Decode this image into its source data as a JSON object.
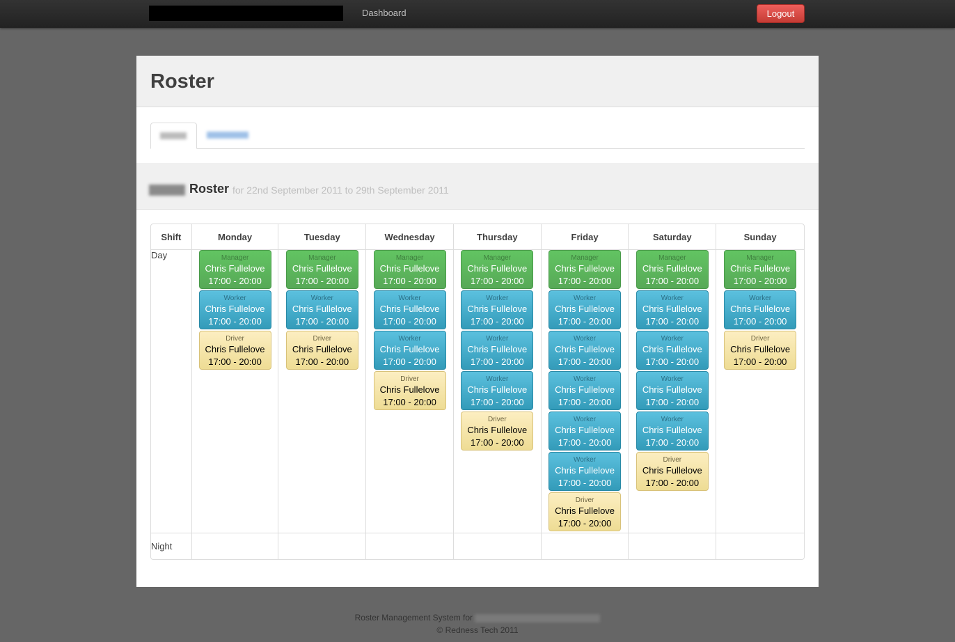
{
  "topbar": {
    "nav_label": "Dashboard",
    "logout_label": "Logout"
  },
  "page": {
    "title": "Roster"
  },
  "roster": {
    "heading": "Roster",
    "subtitle": "for 22nd September 2011 to 29th September 2011"
  },
  "table": {
    "shift_header": "Shift",
    "days": [
      "Monday",
      "Tuesday",
      "Wednesday",
      "Thursday",
      "Friday",
      "Saturday",
      "Sunday"
    ],
    "rows": [
      {
        "label": "Day",
        "days": [
          [
            {
              "role": "Manager",
              "color": "green",
              "name": "Chris Fullelove",
              "time": "17:00 - 20:00"
            },
            {
              "role": "Worker",
              "color": "blue",
              "name": "Chris Fullelove",
              "time": "17:00 - 20:00"
            },
            {
              "role": "Driver",
              "color": "yellow",
              "name": "Chris Fullelove",
              "time": "17:00 - 20:00"
            }
          ],
          [
            {
              "role": "Manager",
              "color": "green",
              "name": "Chris Fullelove",
              "time": "17:00 - 20:00"
            },
            {
              "role": "Worker",
              "color": "blue",
              "name": "Chris Fullelove",
              "time": "17:00 - 20:00"
            },
            {
              "role": "Driver",
              "color": "yellow",
              "name": "Chris Fullelove",
              "time": "17:00 - 20:00"
            }
          ],
          [
            {
              "role": "Manager",
              "color": "green",
              "name": "Chris Fullelove",
              "time": "17:00 - 20:00"
            },
            {
              "role": "Worker",
              "color": "blue",
              "name": "Chris Fullelove",
              "time": "17:00 - 20:00"
            },
            {
              "role": "Worker",
              "color": "blue",
              "name": "Chris Fullelove",
              "time": "17:00 - 20:00"
            },
            {
              "role": "Driver",
              "color": "yellow",
              "name": "Chris Fullelove",
              "time": "17:00 - 20:00"
            }
          ],
          [
            {
              "role": "Manager",
              "color": "green",
              "name": "Chris Fullelove",
              "time": "17:00 - 20:00"
            },
            {
              "role": "Worker",
              "color": "blue",
              "name": "Chris Fullelove",
              "time": "17:00 - 20:00"
            },
            {
              "role": "Worker",
              "color": "blue",
              "name": "Chris Fullelove",
              "time": "17:00 - 20:00"
            },
            {
              "role": "Worker",
              "color": "blue",
              "name": "Chris Fullelove",
              "time": "17:00 - 20:00"
            },
            {
              "role": "Driver",
              "color": "yellow",
              "name": "Chris Fullelove",
              "time": "17:00 - 20:00"
            }
          ],
          [
            {
              "role": "Manager",
              "color": "green",
              "name": "Chris Fullelove",
              "time": "17:00 - 20:00"
            },
            {
              "role": "Worker",
              "color": "blue",
              "name": "Chris Fullelove",
              "time": "17:00 - 20:00"
            },
            {
              "role": "Worker",
              "color": "blue",
              "name": "Chris Fullelove",
              "time": "17:00 - 20:00"
            },
            {
              "role": "Worker",
              "color": "blue",
              "name": "Chris Fullelove",
              "time": "17:00 - 20:00"
            },
            {
              "role": "Worker",
              "color": "blue",
              "name": "Chris Fullelove",
              "time": "17:00 - 20:00"
            },
            {
              "role": "Worker",
              "color": "blue",
              "name": "Chris Fullelove",
              "time": "17:00 - 20:00"
            },
            {
              "role": "Driver",
              "color": "yellow",
              "name": "Chris Fullelove",
              "time": "17:00 - 20:00"
            }
          ],
          [
            {
              "role": "Manager",
              "color": "green",
              "name": "Chris Fullelove",
              "time": "17:00 - 20:00"
            },
            {
              "role": "Worker",
              "color": "blue",
              "name": "Chris Fullelove",
              "time": "17:00 - 20:00"
            },
            {
              "role": "Worker",
              "color": "blue",
              "name": "Chris Fullelove",
              "time": "17:00 - 20:00"
            },
            {
              "role": "Worker",
              "color": "blue",
              "name": "Chris Fullelove",
              "time": "17:00 - 20:00"
            },
            {
              "role": "Worker",
              "color": "blue",
              "name": "Chris Fullelove",
              "time": "17:00 - 20:00"
            },
            {
              "role": "Driver",
              "color": "yellow",
              "name": "Chris Fullelove",
              "time": "17:00 - 20:00"
            }
          ],
          [
            {
              "role": "Manager",
              "color": "green",
              "name": "Chris Fullelove",
              "time": "17:00 - 20:00"
            },
            {
              "role": "Worker",
              "color": "blue",
              "name": "Chris Fullelove",
              "time": "17:00 - 20:00"
            },
            {
              "role": "Driver",
              "color": "yellow",
              "name": "Chris Fullelove",
              "time": "17:00 - 20:00"
            }
          ]
        ]
      },
      {
        "label": "Night",
        "days": [
          [],
          [],
          [],
          [],
          [],
          [],
          []
        ]
      }
    ]
  },
  "footer": {
    "line1": "Roster Management System for",
    "line2": "© Redness Tech 2011"
  },
  "colors": {
    "manager": "#57a957",
    "worker": "#339bb9",
    "driver": "#eedc94",
    "logout": "#c43c35",
    "background": "#666666"
  }
}
